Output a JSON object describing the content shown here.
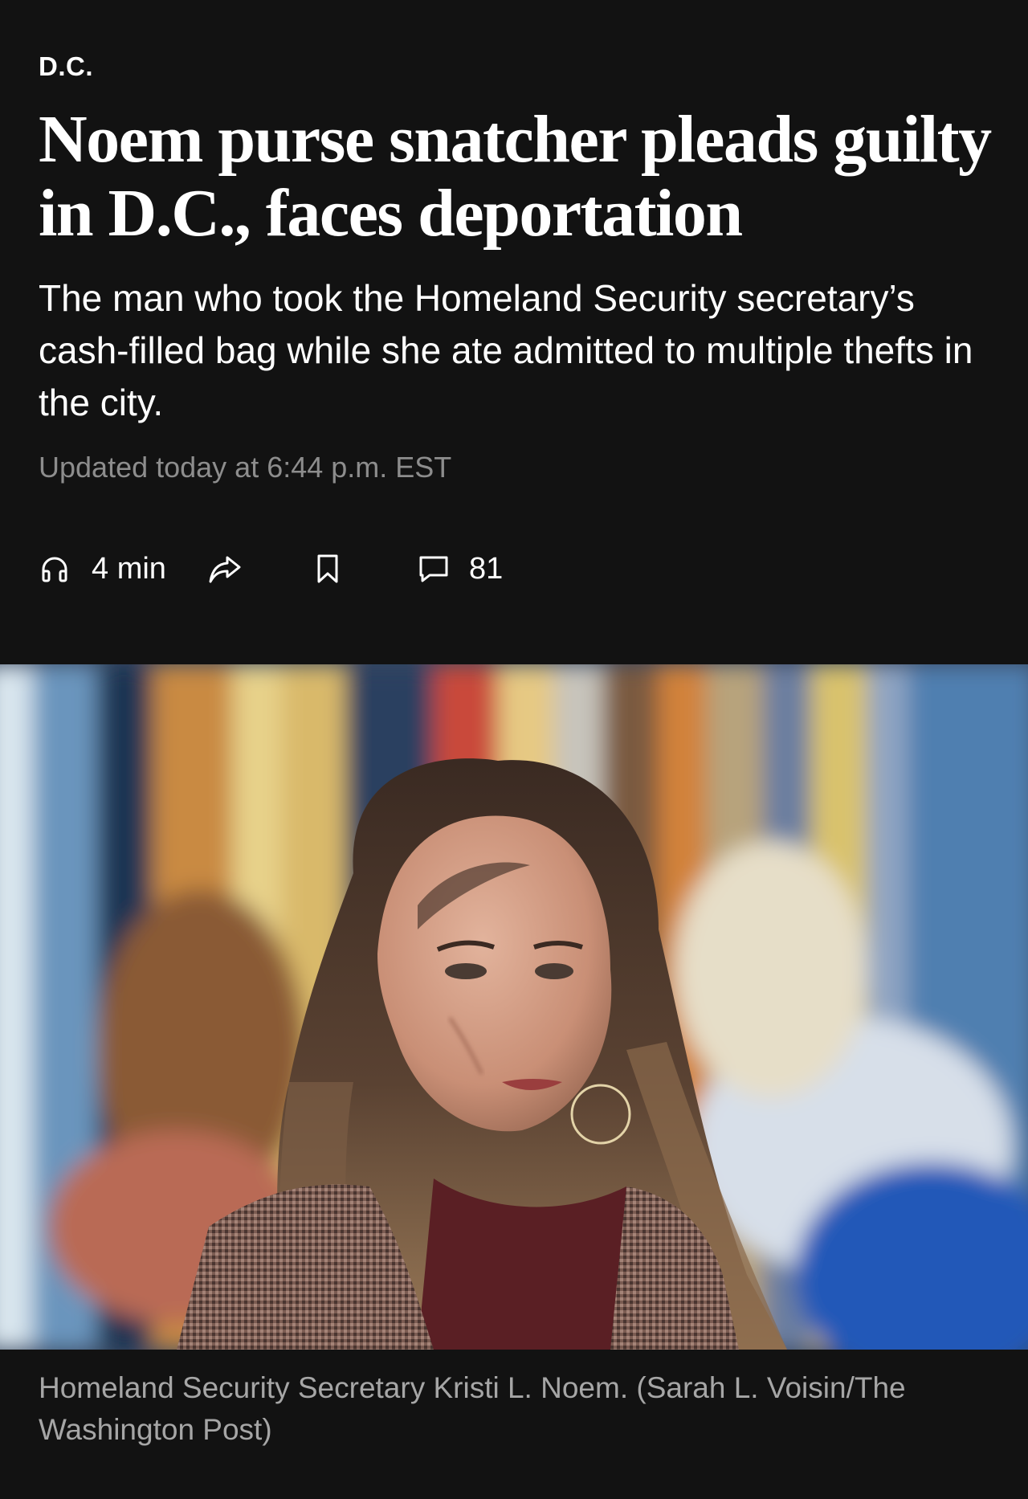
{
  "article": {
    "section": "D.C.",
    "headline": "Noem purse snatcher pleads guilty in D.C., faces deportation",
    "dek": "The man who took the Homeland Security secretary’s cash-filled bag while she ate admitted to multiple thefts in the city.",
    "timestamp": "Updated today at 6:44 p.m. EST"
  },
  "actions": {
    "listen": {
      "icon": "headphones-icon",
      "label": "4 min"
    },
    "share": {
      "icon": "share-icon"
    },
    "save": {
      "icon": "bookmark-icon"
    },
    "comments": {
      "icon": "comment-icon",
      "count": "81"
    }
  },
  "photo": {
    "caption": "Homeland Security Secretary Kristi L. Noem. (Sarah L. Voisin/The Washington Post)"
  },
  "colors": {
    "background": "#121212",
    "text": "#ffffff",
    "timestamp": "#8d8d8d",
    "caption": "#a6a6a6"
  }
}
